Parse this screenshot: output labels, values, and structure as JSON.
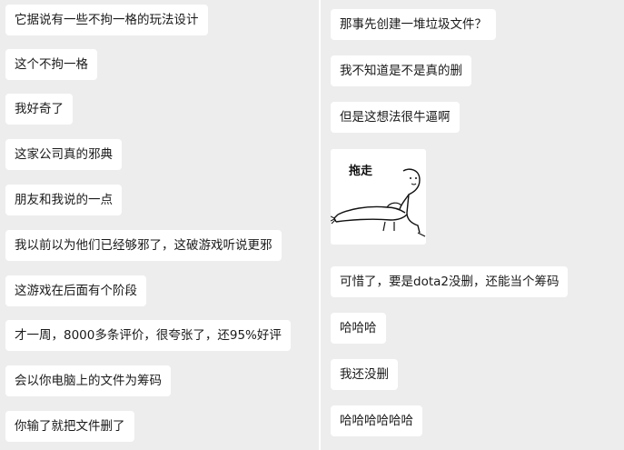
{
  "left_messages": [
    "它据说有一些不拘一格的玩法设计",
    "这个不拘一格",
    "我好奇了",
    "这家公司真的邪典",
    "朋友和我说的一点",
    "我以前以为他们已经够邪了，这破游戏听说更邪",
    "这游戏在后面有个阶段",
    "才一周，8000多条评价，很夸张了，还95%好评",
    "会以你电脑上的文件为筹码",
    "你输了就把文件删了"
  ],
  "right_messages_top": [
    "那事先创建一堆垃圾文件？",
    "我不知道是不是真的删",
    "但是这想法很牛逼啊"
  ],
  "sticker": {
    "caption": "拖走"
  },
  "right_messages_bottom": [
    "可惜了，要是dota2没删，还能当个筹码",
    "哈哈哈",
    "我还没删",
    "哈哈哈哈哈哈"
  ]
}
